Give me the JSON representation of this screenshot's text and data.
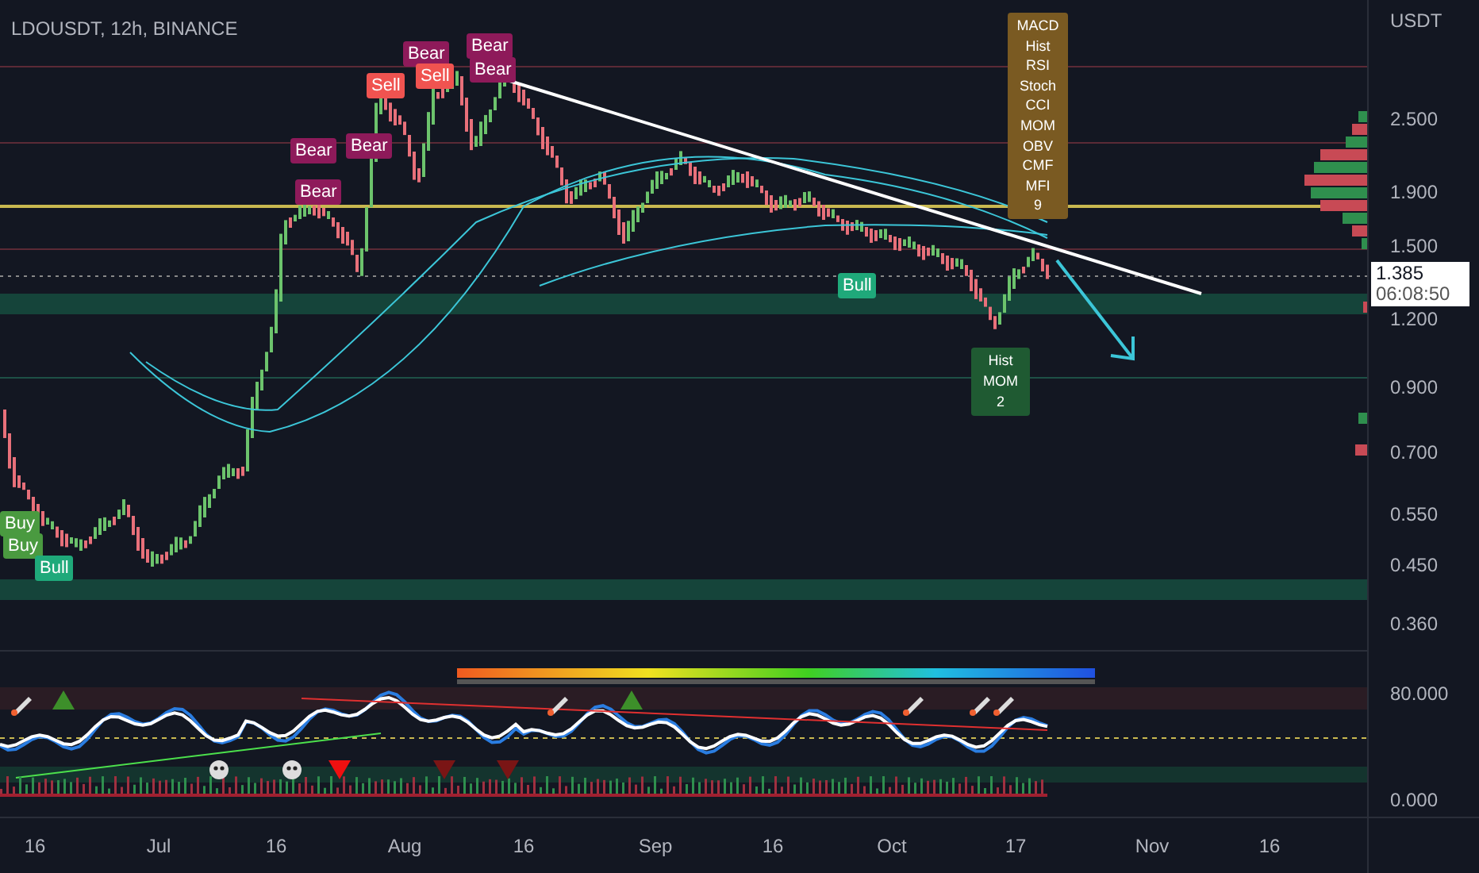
{
  "chart": {
    "title": "LDOUSDT, 12h, BINANCE",
    "currency": "USDT"
  },
  "price_axis": [
    "2.500",
    "1.900",
    "1.500",
    "1.200",
    "0.900",
    "0.700",
    "0.550",
    "0.450",
    "0.360"
  ],
  "current_price": {
    "value": "1.385",
    "countdown": "06:08:50"
  },
  "signals": [
    {
      "kind": "bear",
      "label": "Bear"
    },
    {
      "kind": "bear",
      "label": "Bear"
    },
    {
      "kind": "bear",
      "label": "Bear"
    },
    {
      "kind": "sell",
      "label": "Sell"
    },
    {
      "kind": "bear",
      "label": "Bear"
    },
    {
      "kind": "sell",
      "label": "Sell"
    },
    {
      "kind": "bear",
      "label": "Bear"
    },
    {
      "kind": "bear",
      "label": "Bear"
    },
    {
      "kind": "bull",
      "label": "Bull"
    },
    {
      "kind": "buy",
      "label": "Buy"
    },
    {
      "kind": "buy",
      "label": "Buy"
    },
    {
      "kind": "bull",
      "label": "Bull"
    }
  ],
  "divergence_box": {
    "lines": [
      "MACD",
      "Hist",
      "RSI",
      "Stoch",
      "CCI",
      "MOM",
      "OBV",
      "CMF",
      "MFI",
      "9"
    ]
  },
  "bull_divergence_box": {
    "lines": [
      "Hist",
      "MOM",
      "2"
    ]
  },
  "oscillator_axis": [
    "80.000",
    "0.000"
  ],
  "time_axis": [
    "16",
    "Jul",
    "16",
    "Aug",
    "16",
    "Sep",
    "16",
    "Oct",
    "17",
    "Nov",
    "16"
  ]
}
